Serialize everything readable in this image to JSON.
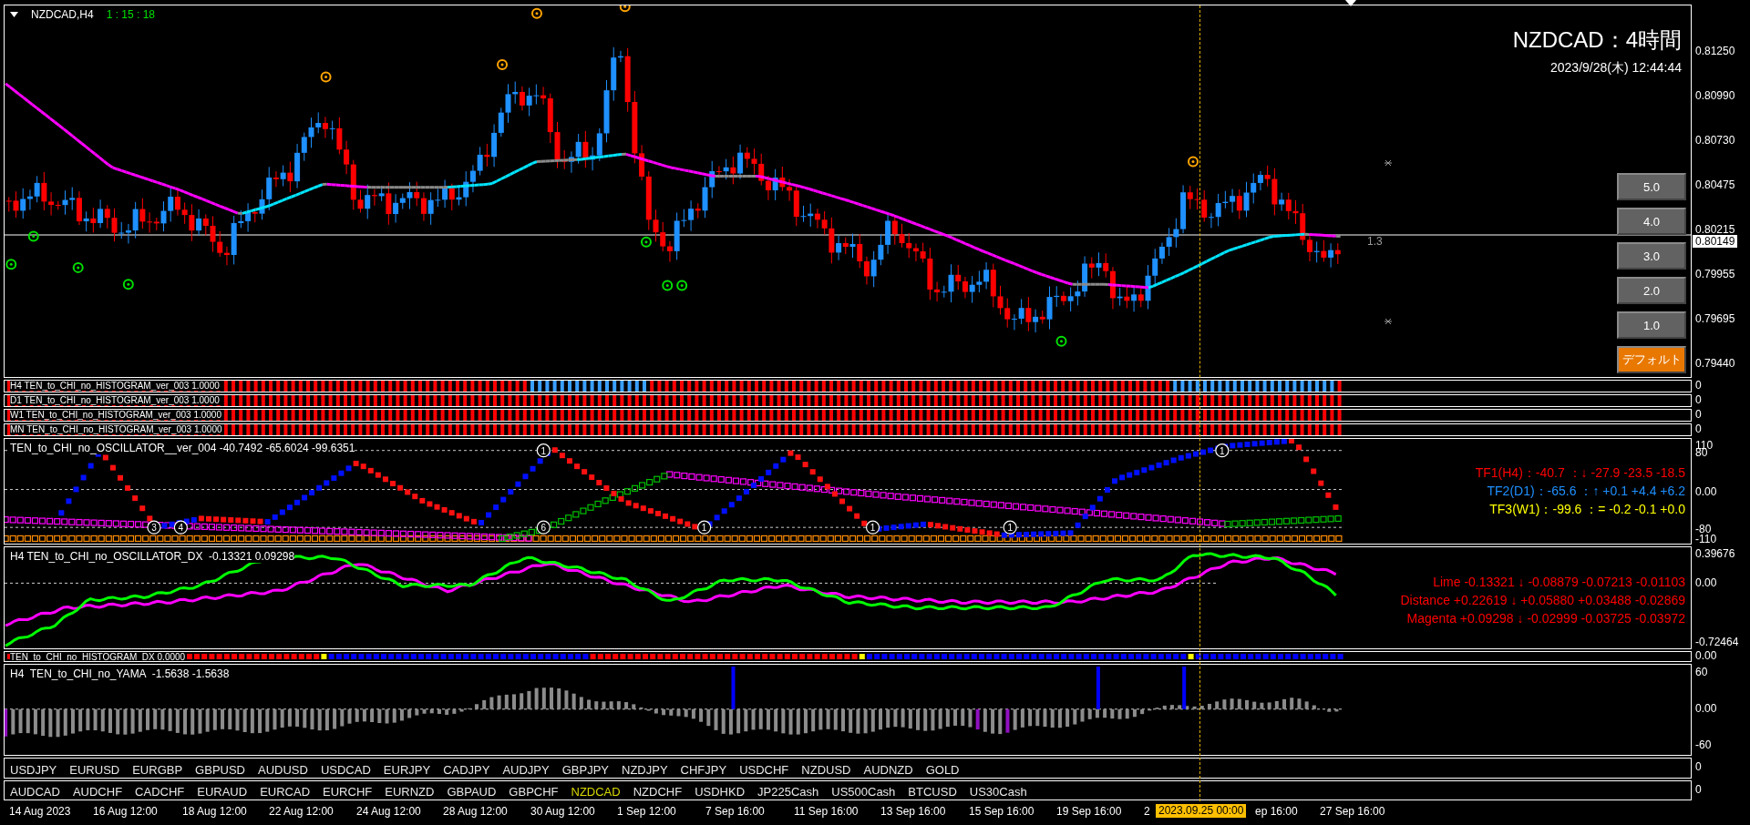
{
  "main_chart": {
    "symbol": "NZDCAD,H4",
    "countdown": "1 : 15 : 18",
    "title": "NZDCAD：4時間",
    "datetime": "2023/9/28(木) 12:44:44",
    "ratio_label": "1.3",
    "price_axis": [
      "0.81250",
      "0.80990",
      "0.80730",
      "0.80475",
      "0.80215",
      "0.79955",
      "0.79695",
      "0.79440"
    ],
    "current_price": "0.80149",
    "buttons": [
      {
        "label": "5.0",
        "kind": "level"
      },
      {
        "label": "4.0",
        "kind": "level"
      },
      {
        "label": "3.0",
        "kind": "level"
      },
      {
        "label": "2.0",
        "kind": "level"
      },
      {
        "label": "1.0",
        "kind": "level"
      },
      {
        "label": "デフォルト",
        "kind": "default"
      }
    ]
  },
  "histograms": [
    {
      "label": "H4 TEN_to_CHI_no_HISTOGRAM_ver_003 1.0000",
      "axis": "0"
    },
    {
      "label": "D1 TEN_to_CHI_no_HISTOGRAM_ver_003 1.0000",
      "axis": "0"
    },
    {
      "label": "W1 TEN_to_CHI_no_HISTOGRAM_ver_003 1.0000",
      "axis": "0"
    },
    {
      "label": "MN TEN_to_CHI_no_HISTOGRAM_ver_003 1.0000",
      "axis": "0"
    }
  ],
  "oscillator": {
    "label": "TEN_to_CHI_no_OSCILLATOR__ver_004 -40.7492 -65.6024 -99.6351",
    "axis": [
      "110",
      "80",
      "0.00",
      "-80",
      "-110"
    ],
    "markers": [
      "3",
      "4",
      "1",
      "6",
      "1",
      "1",
      "1",
      "1"
    ],
    "readouts": [
      {
        "text": "TF1(H4)：-40.7 ：↓ -27.9 -23.5 -18.5",
        "color": "#ff0000"
      },
      {
        "text": "TF2(D1)：-65.6 ：↑ +0.1 +4.4 +6.2",
        "color": "#1e90ff"
      },
      {
        "text": "TF3(W1)：-99.6 ：= -0.2 -0.1 +0.0",
        "color": "#ffff00"
      }
    ]
  },
  "oscillator_dx": {
    "label": "H4 TEN_to_CHI_no_OSCILLATOR_DX  -0.13321 0.09298",
    "axis": [
      "0.39676",
      "0.00",
      "-0.72464"
    ],
    "readouts": [
      {
        "text": "Lime -0.13321 ↓ -0.08879 -0.07213 -0.01103",
        "color": "#ff0000"
      },
      {
        "text": "Distance +0.22619 ↓ +0.05880 +0.03488 -0.02869",
        "color": "#ff0000"
      },
      {
        "text": "Magenta +0.09298 ↓ -0.02999 -0.03725 -0.03972",
        "color": "#ff0000"
      }
    ]
  },
  "histogram_dx": {
    "label": "TEN_to_CHI_no_HISTOGRAM_DX 0.0000",
    "axis": "0.00"
  },
  "yama": {
    "label": "H4  TEN_to_CHI_no_YAMA  -1.5638 -1.5638",
    "axis": [
      "60",
      "0.00",
      "-60"
    ]
  },
  "symbol_bars": [
    {
      "axis": "0",
      "symbols": [
        {
          "label": "USDJPY",
          "selected": false
        },
        {
          "label": "EURUSD",
          "selected": false
        },
        {
          "label": "EURGBP",
          "selected": false
        },
        {
          "label": "GBPUSD",
          "selected": false
        },
        {
          "label": "AUDUSD",
          "selected": false
        },
        {
          "label": "USDCAD",
          "selected": false
        },
        {
          "label": "EURJPY",
          "selected": false
        },
        {
          "label": "CADJPY",
          "selected": false
        },
        {
          "label": "AUDJPY",
          "selected": false
        },
        {
          "label": "GBPJPY",
          "selected": false
        },
        {
          "label": "NZDJPY",
          "selected": false
        },
        {
          "label": "CHFJPY",
          "selected": false
        },
        {
          "label": "USDCHF",
          "selected": false
        },
        {
          "label": "NZDUSD",
          "selected": false
        },
        {
          "label": "AUDNZD",
          "selected": false
        },
        {
          "label": "GOLD",
          "selected": false
        }
      ]
    },
    {
      "axis": "0",
      "symbols": [
        {
          "label": "AUDCAD",
          "selected": false
        },
        {
          "label": "AUDCHF",
          "selected": false
        },
        {
          "label": "CADCHF",
          "selected": false
        },
        {
          "label": "EURAUD",
          "selected": false
        },
        {
          "label": "EURCAD",
          "selected": false
        },
        {
          "label": "EURCHF",
          "selected": false
        },
        {
          "label": "EURNZD",
          "selected": false
        },
        {
          "label": "GBPAUD",
          "selected": false
        },
        {
          "label": "GBPCHF",
          "selected": false
        },
        {
          "label": "NZDCAD",
          "selected": true
        },
        {
          "label": "NZDCHF",
          "selected": false
        },
        {
          "label": "USDHKD",
          "selected": false
        },
        {
          "label": "JP225Cash",
          "selected": false
        },
        {
          "label": "US500Cash",
          "selected": false
        },
        {
          "label": "BTCUSD",
          "selected": false
        },
        {
          "label": "US30Cash",
          "selected": false
        }
      ]
    }
  ],
  "time_axis": {
    "labels": [
      "14 Aug 2023",
      "16 Aug 12:00",
      "18 Aug 12:00",
      "22 Aug 12:00",
      "24 Aug 12:00",
      "28 Aug 12:00",
      "30 Aug 12:00",
      "1 Sep 12:00",
      "7 Sep 16:00",
      "11 Sep 16:00",
      "13 Sep 16:00",
      "15 Sep 16:00",
      "19 Sep 16:00",
      "2",
      "ep 16:00",
      "27 Sep 16:00"
    ],
    "cursor_time": "2023.09.25 00:00"
  }
}
